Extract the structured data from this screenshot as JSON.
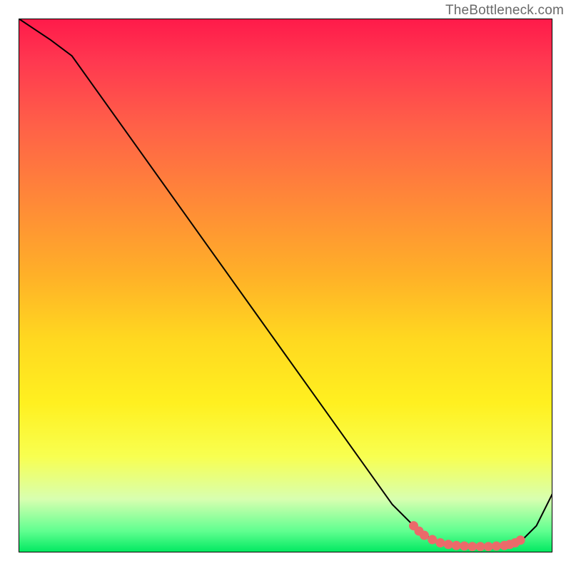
{
  "watermark": "TheBottleneck.com",
  "chart_data": {
    "type": "line",
    "title": "",
    "xlabel": "",
    "ylabel": "",
    "xlim": [
      0,
      100
    ],
    "ylim": [
      0,
      100
    ],
    "series": [
      {
        "name": "curve",
        "x": [
          0,
          6,
          10,
          15,
          20,
          25,
          30,
          35,
          40,
          45,
          50,
          55,
          60,
          65,
          70,
          74,
          78,
          80,
          82,
          84,
          86,
          88,
          90,
          92,
          94,
          97,
          100
        ],
        "y": [
          100,
          96,
          93,
          86,
          79,
          72,
          65,
          58,
          51,
          44,
          37,
          30,
          23,
          16,
          9,
          5,
          2,
          1.5,
          1.2,
          1,
          1,
          1,
          1,
          1.2,
          2,
          5,
          11
        ]
      }
    ],
    "markers": {
      "name": "highlighted-points",
      "color": "#eb6a6a",
      "x": [
        74,
        75,
        76,
        77.5,
        79,
        80.5,
        82,
        83.5,
        85,
        86.5,
        88,
        89.5,
        91,
        92,
        93,
        94
      ],
      "y": [
        5,
        4,
        3.2,
        2.4,
        1.8,
        1.5,
        1.3,
        1.2,
        1.1,
        1.1,
        1.1,
        1.2,
        1.3,
        1.5,
        1.8,
        2.3
      ]
    },
    "background_gradient": {
      "stops": [
        {
          "pos": 0,
          "color": "#ff1a4a"
        },
        {
          "pos": 8,
          "color": "#ff3850"
        },
        {
          "pos": 20,
          "color": "#ff6048"
        },
        {
          "pos": 34,
          "color": "#ff8838"
        },
        {
          "pos": 48,
          "color": "#ffb028"
        },
        {
          "pos": 60,
          "color": "#ffd820"
        },
        {
          "pos": 72,
          "color": "#fff020"
        },
        {
          "pos": 82,
          "color": "#f8ff50"
        },
        {
          "pos": 90,
          "color": "#d8ffb0"
        },
        {
          "pos": 96,
          "color": "#60ff90"
        },
        {
          "pos": 100,
          "color": "#00e860"
        }
      ]
    }
  }
}
